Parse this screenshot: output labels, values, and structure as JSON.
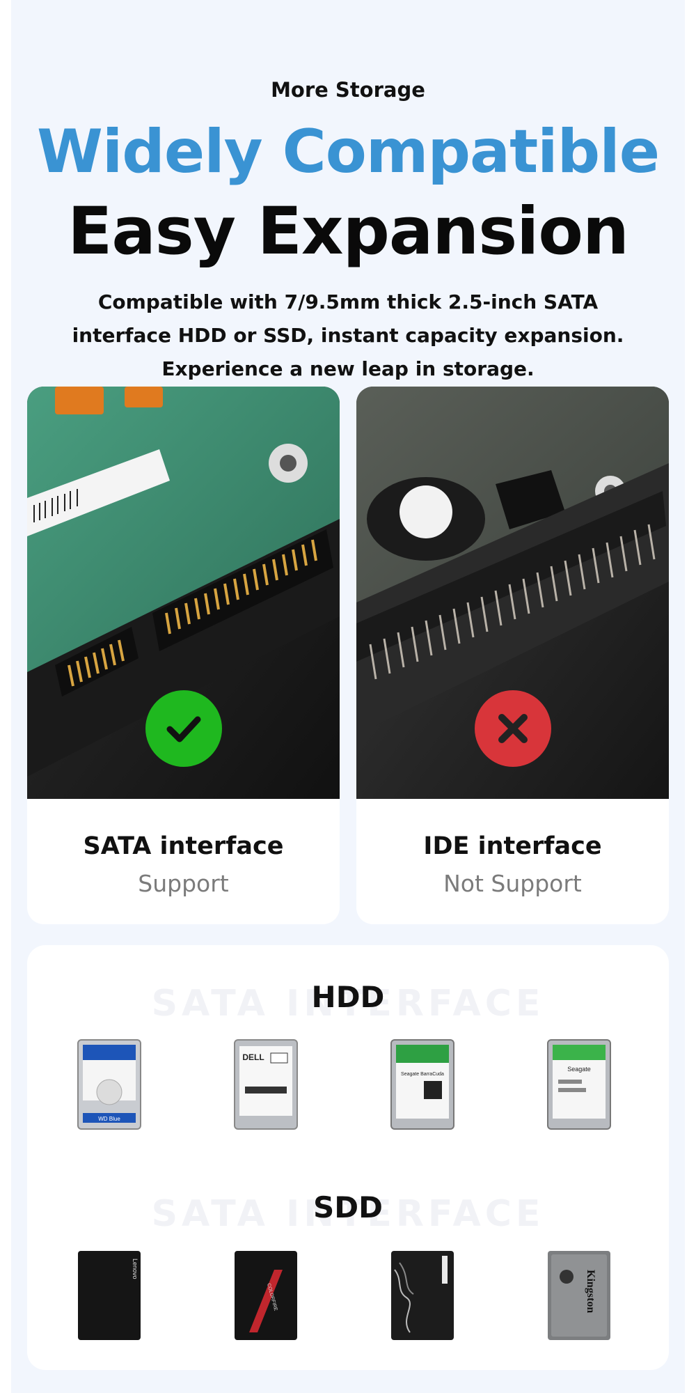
{
  "header": {
    "eyebrow": "More Storage",
    "headline_1": "Widely Compatible",
    "headline_2": "Easy Expansion",
    "description": "Compatible with 7/9.5mm thick 2.5-inch SATA interface HDD or SSD, instant capacity expansion. Experience a new leap in storage."
  },
  "cards": [
    {
      "title": "SATA interface",
      "status": "Support",
      "badge_icon": "check-icon",
      "badge_color": "#1fb81f"
    },
    {
      "title": "IDE interface",
      "status": "Not Support",
      "badge_icon": "cross-icon",
      "badge_color": "#d8353a"
    }
  ],
  "sections": [
    {
      "watermark": "SATA INTERFACE",
      "title": "HDD",
      "items": [
        "WD Blue",
        "DELL",
        "Seagate BarraCuda",
        "Seagate"
      ]
    },
    {
      "watermark": "SATA INTERFACE",
      "title": "SDD",
      "items": [
        "Lenovo",
        "COLORFIRE",
        "",
        "Kingston"
      ]
    }
  ],
  "colors": {
    "accent_blue": "#3a93d3",
    "background": "#f2f6fd",
    "pcb_green": "#3f8f70"
  }
}
